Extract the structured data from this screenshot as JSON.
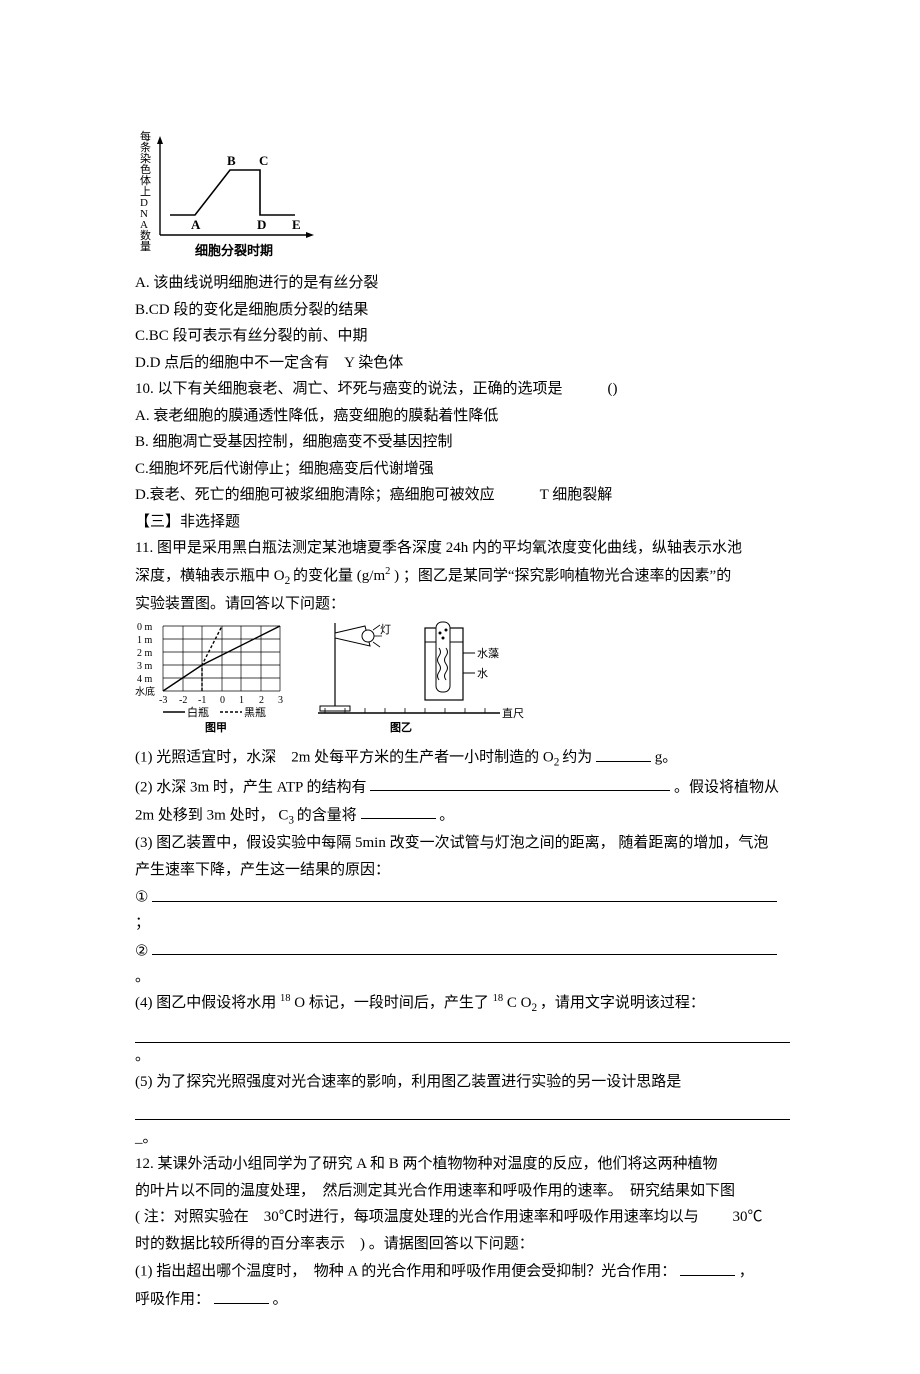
{
  "chart_data": [
    {
      "type": "line",
      "title": "",
      "xlabel": "细胞分裂时期",
      "ylabel": "每条染色体上DNA数量",
      "points_labeled": [
        "A",
        "B",
        "C",
        "D",
        "E"
      ],
      "pattern": "holds low at A, rises to B, plateau to C, drops to D, holds low to E"
    },
    {
      "type": "line",
      "title": "图甲",
      "ylabel": "",
      "y_ticks": [
        "0 m",
        "1 m",
        "2 m",
        "3 m",
        "4 m",
        "水底"
      ],
      "x_ticks": [
        -3,
        -2,
        -1,
        0,
        1,
        2,
        3
      ],
      "series_legend": [
        "白瓶",
        "黑瓶"
      ]
    },
    {
      "type": "diagram",
      "title": "图乙",
      "elements": [
        "灯",
        "水藻",
        "水",
        "直尺"
      ]
    }
  ],
  "q9": {
    "optA": "A. 该曲线说明细胞进行的是有丝分裂",
    "optB": "B.CD 段的变化是细胞质分裂的结果",
    "optC": "C.BC 段可表示有丝分裂的前、中期",
    "optD": "D.D 点后的细胞中不一定含有　Y 染色体"
  },
  "q10": {
    "stem": "10. 以下有关细胞衰老、凋亡、坏死与癌变的说法，正确的选项是　　　()",
    "optA": "A. 衰老细胞的膜通透性降低，癌变细胞的膜黏着性降低",
    "optB": "B. 细胞凋亡受基因控制，细胞癌变不受基因控制",
    "optC": "C.细胞坏死后代谢停止；细胞癌变后代谢增强",
    "optD": "D.衰老、死亡的细胞可被浆细胞清除；癌细胞可被效应　　　T 细胞裂解"
  },
  "section3": "【三】非选择题",
  "q11": {
    "stem1": "11. 图甲是采用黑白瓶法测定某池塘夏季各深度 24h 内的平均氧浓度变化曲线，纵轴表示水池",
    "stem2_a": "深度，横轴表示瓶中 O",
    "stem2_b": "的变化量 (g/m",
    "stem2_c": ") ；图乙是某同学“探究影响植物光合速率的因素”的",
    "stem3": "实验装置图。请回答以下问题：",
    "fig_labels": {
      "y0": "0 m",
      "y1": "1 m",
      "y2": "2 m",
      "y3": "3 m",
      "y4": "4 m",
      "y5": "水底",
      "xneg3": "-3",
      "xneg2": "-2",
      "xneg1": "-1",
      "x0": "0",
      "x1": "1",
      "x2": "2",
      "x3": "3",
      "white": "白瓶",
      "black": "黑瓶",
      "figA": "图甲",
      "figB": "图乙",
      "lamp": "灯",
      "algae": "水藻",
      "water": "水",
      "ruler": "直尺"
    },
    "p1_a": "(1) 光照适宜时，水深　2m 处每平方米的生产者一小时制造的 O",
    "p1_b": "约为",
    "p1_c": "g。",
    "p2_a": "(2) 水深 3m 时，产生 ATP 的结构有",
    "p2_b": "。假设将植物从",
    "p2_c": "2m 处移到  3m 处时， C",
    "p2_d": "的含量将",
    "p2_e": "。",
    "p3_a": "(3) 图乙装置中，假设实验中每隔 5min 改变一次试管与灯泡之间的距离， 随着距离的增加，气泡",
    "p3_b": "产生速率下降，产生这一结果的原因：",
    "p3_circle1": "①",
    "p3_semicolon": "；",
    "p3_circle2": "②",
    "p3_period": "。",
    "p4_a": "(4) 图乙中假设将水用",
    "p4_sup1": "18",
    "p4_b": "O 标记，一段时间后，产生了",
    "p4_sup2": "18",
    "p4_c": "C O",
    "p4_d": "，请用文字说明该过程：",
    "p4_period": "。",
    "p5_a": "(5) 为了探究光照强度对光合速率的影响，利用图乙装置进行实验的另一设计思路是",
    "p5_b": "_。"
  },
  "q12": {
    "line1": "12. 某课外活动小组同学为了研究 A 和 B 两个植物物种对温度的反应，他们将这两种植物",
    "line2": "的叶片以不同的温度处理，　然后测定其光合作用速率和呼吸作用的速率。　研究结果如下图",
    "line3": "( 注：对照实验在　30℃时进行，每项温度处理的光合作用速率和呼吸作用速率均以与　　 30℃",
    "line4": "时的数据比较所得的百分率表示　) 。请据图回答以下问题：",
    "p1_a": "(1) 指出超出哪个温度时，　物种  A  的光合作用和呼吸作用便会受抑制？光合作用：",
    "p1_b": "，",
    "p1_c": "呼吸作用：",
    "p1_d": "。"
  },
  "graph1": {
    "ylabel": "每条染色体上DNA数量",
    "xlabel": "细胞分裂时期",
    "A": "A",
    "B": "B",
    "C": "C",
    "D": "D",
    "E": "E"
  }
}
